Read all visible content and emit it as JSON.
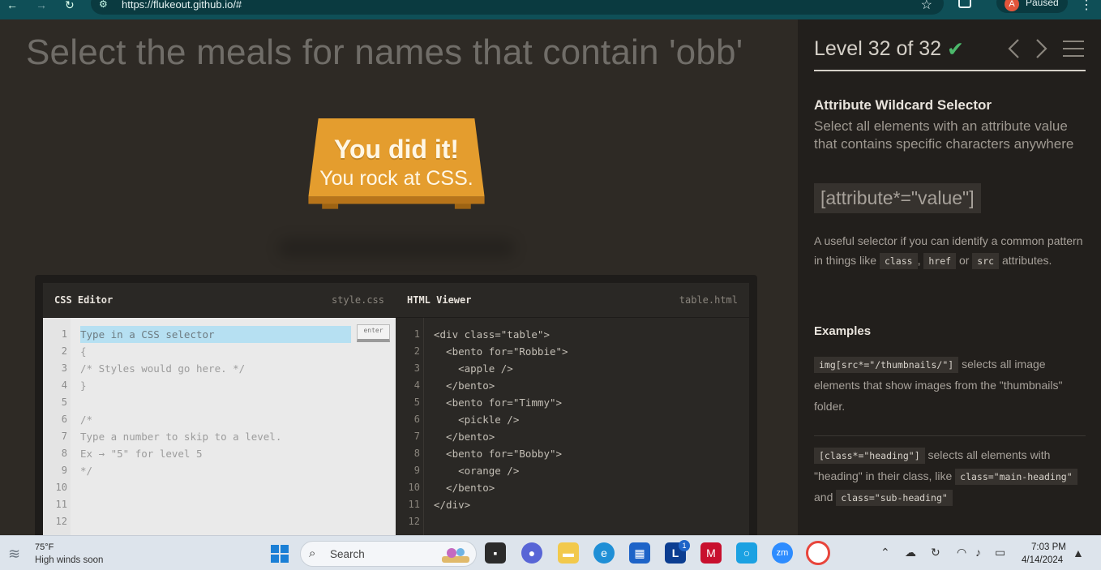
{
  "browser": {
    "url": "https://flukeout.github.io/#",
    "profile_initial": "A",
    "profile_status": "Paused"
  },
  "game": {
    "instruction": "Select the meals for names that contain 'obb'",
    "win_line1": "You did it!",
    "win_line2": "You rock at CSS.",
    "table_color": "#e49d2e"
  },
  "css_editor": {
    "title": "CSS Editor",
    "file": "style.css",
    "input_placeholder": "Type in a CSS selector",
    "enter_label": "enter",
    "line_numbers": [
      "1",
      "2",
      "3",
      "4",
      "5",
      "6",
      "7",
      "8",
      "9",
      "10",
      "11",
      "12"
    ],
    "lines": [
      "{",
      "/* Styles would go here. */",
      "}",
      "",
      "/*",
      "Type a number to skip to a level.",
      "Ex → \"5\" for level 5",
      "*/"
    ]
  },
  "html_viewer": {
    "title": "HTML Viewer",
    "file": "table.html",
    "line_numbers": [
      "1",
      "2",
      "3",
      "4",
      "5",
      "6",
      "7",
      "8",
      "9",
      "10",
      "11",
      "12"
    ],
    "lines": [
      "<div class=\"table\">",
      "  <bento for=\"Robbie\">",
      "    <apple />",
      "  </bento>",
      "  <bento for=\"Timmy\">",
      "    <pickle />",
      "  </bento>",
      "  <bento for=\"Bobby\">",
      "    <orange />",
      "  </bento>",
      "</div>",
      ""
    ]
  },
  "sidebar": {
    "level_text": "Level 32 of 32",
    "level_complete": true,
    "progress": 1.0,
    "selector_name": "Attribute Wildcard Selector",
    "selector_title": "Select all elements with an attribute value that contains specific characters anywhere",
    "syntax": "[attribute*=\"value\"]",
    "hint_prefix": "A useful selector if you can identify a common pattern in things like",
    "hint_chip1": "class",
    "hint_sep1": ",",
    "hint_chip2": "href",
    "hint_sep2": "or",
    "hint_chip3": "src",
    "hint_suffix": "attributes.",
    "examples_title": "Examples",
    "example1_code": "img[src*=\"/thumbnails/\"]",
    "example1_text": "selects all image elements that show images from the \"thumbnails\" folder.",
    "example2_code": "[class*=\"heading\"]",
    "example2_text1": "selects all elements with \"heading\" in their class, like",
    "example2_code2": "class=\"main-heading\"",
    "example2_and": "and",
    "example2_code3": "class=\"sub-heading\""
  },
  "taskbar": {
    "temperature": "75°F",
    "weather": "High winds soon",
    "search_label": "Search",
    "time": "7:03 PM",
    "date": "4/14/2024",
    "badge_count": "1"
  }
}
